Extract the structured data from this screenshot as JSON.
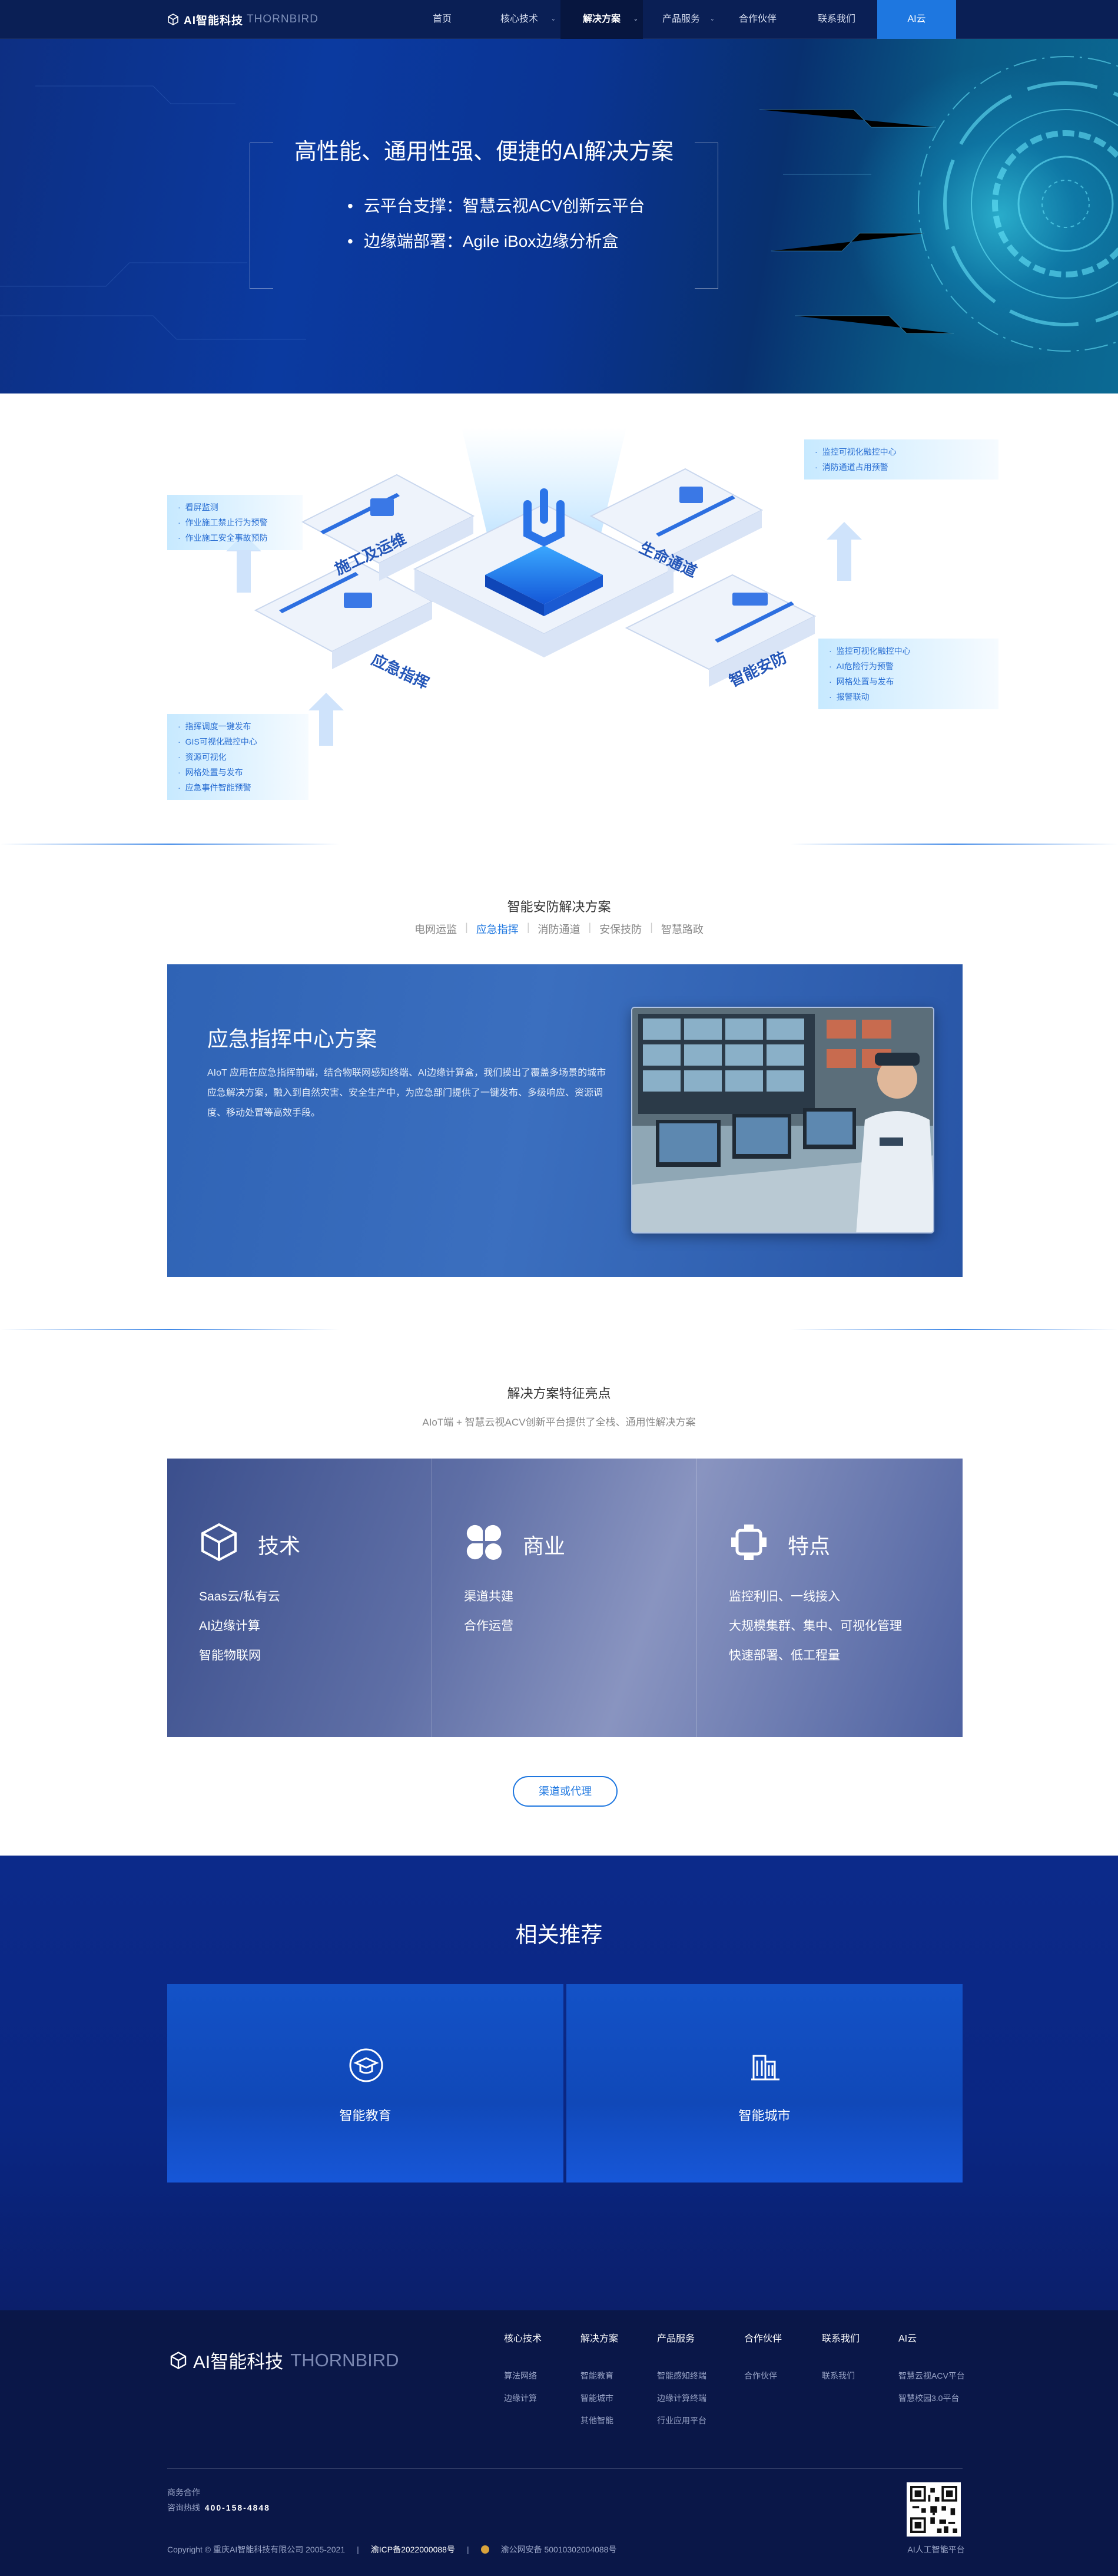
{
  "nav": {
    "brand_cn": "AI智能科技",
    "brand_en": "THORNBIRD",
    "items": [
      {
        "label": "首页"
      },
      {
        "label": "核心技术"
      },
      {
        "label": "解决方案"
      },
      {
        "label": "产品服务"
      },
      {
        "label": "合作伙伴"
      },
      {
        "label": "联系我们"
      },
      {
        "label": "AI云"
      }
    ],
    "active_index": 2
  },
  "hero": {
    "title": "高性能、通用性强、便捷的AI解决方案",
    "bullets": [
      "云平台支撑：智慧云视ACV创新云平台",
      "边缘端部署：Agile iBox边缘分析盒"
    ]
  },
  "illustration": {
    "zones": [
      "施工及运维",
      "应急指挥",
      "生命通道",
      "智能安防"
    ],
    "card_top_left": [
      "看屏监测",
      "作业施工禁止行为预警",
      "作业施工安全事故预防"
    ],
    "card_top_right": [
      "监控可视化融控中心",
      "消防通道占用预警"
    ],
    "card_bottom_left": [
      "指挥调度一键发布",
      "GIS可视化融控中心",
      "资源可视化",
      "网格处置与发布",
      "应急事件智能预警"
    ],
    "card_bottom_right": [
      "监控可视化融控中心",
      "AI危险行为预警",
      "网格处置与发布",
      "报警联动"
    ]
  },
  "solutions": {
    "title": "智能安防解决方案",
    "tabs": [
      "电网运监",
      "应急指挥",
      "消防通道",
      "安保技防",
      "智慧路政"
    ],
    "active_tab": 1,
    "card_title": "应急指挥中心方案",
    "card_desc": "AIoT 应用在应急指挥前端，结合物联网感知终端、AI边缘计算盒，我们摸出了覆盖多场景的城市应急解决方案，融入到自然灾害、安全生产中，为应急部门提供了一键发布、多级响应、资源调度、移动处置等高效手段。"
  },
  "features": {
    "title": "解决方案特征亮点",
    "subtitle": "AIoT端 + 智慧云视ACV创新平台提供了全栈、通用性解决方案",
    "columns": [
      {
        "icon": "cube-icon",
        "title": "技术",
        "items": [
          "Saas云/私有云",
          "AI边缘计算",
          "智能物联网"
        ]
      },
      {
        "icon": "clover-icon",
        "title": "商业",
        "items": [
          "渠道共建",
          "合作运营"
        ]
      },
      {
        "icon": "frame-icon",
        "title": "特点",
        "items": [
          "监控利旧、一线接入",
          "大规模集群、集中、可视化管理",
          "快速部署、低工程量"
        ]
      }
    ],
    "button": "渠道或代理"
  },
  "related": {
    "title": "相关推荐",
    "cards": [
      {
        "icon": "education-icon",
        "label": "智能教育"
      },
      {
        "icon": "city-icon",
        "label": "智能城市"
      }
    ]
  },
  "footer": {
    "brand_cn": "AI智能科技",
    "brand_en": "THORNBIRD",
    "columns": [
      {
        "title": "核心技术",
        "links": [
          "算法网络",
          "边缘计算"
        ]
      },
      {
        "title": "解决方案",
        "links": [
          "智能教育",
          "智能城市",
          "其他智能"
        ]
      },
      {
        "title": "产品服务",
        "links": [
          "智能感知终端",
          "边缘计算终端",
          "行业应用平台"
        ]
      },
      {
        "title": "合作伙伴",
        "links": [
          "合作伙伴"
        ]
      },
      {
        "title": "联系我们",
        "links": [
          "联系我们"
        ]
      },
      {
        "title": "AI云",
        "links": [
          "智慧云视ACV平台",
          "智慧校园3.0平台"
        ]
      }
    ],
    "biz_label": "商务合作",
    "hotline_label": "咨询热线",
    "hotline": "400-158-4848",
    "copyright": "Copyright © 重庆AI智能科技有限公司 2005-2021",
    "icp": "渝ICP备2022000088号",
    "police": "渝公网安备 50010302004088号",
    "qr_caption": "AI人工智能平台"
  }
}
